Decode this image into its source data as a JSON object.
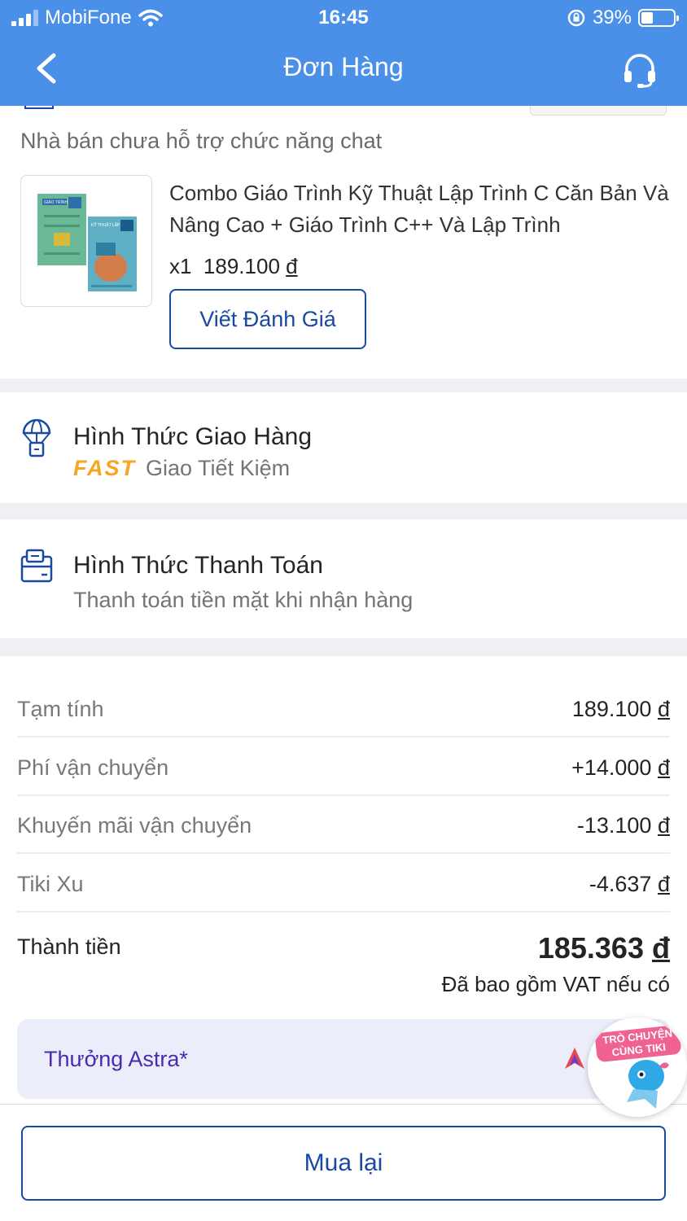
{
  "status_bar": {
    "carrier": "MobiFone",
    "time": "16:45",
    "battery": "39%"
  },
  "header": {
    "title": "Đơn Hàng"
  },
  "seller": {
    "chat_notice": "Nhà bán chưa hỗ trợ chức năng chat"
  },
  "product": {
    "name": "Combo Giáo Trình Kỹ Thuật Lập Trình C Căn Bản Và Nâng Cao + Giáo Trình C++ Và Lập Trình",
    "quantity": "x1",
    "price": "189.100",
    "currency": "đ",
    "review_button": "Viết Đánh Giá",
    "cover1_text": "GIÁO TRÌNH",
    "cover2_text": "KỸ THUẬT LẬP TRÌNH"
  },
  "shipping": {
    "title": "Hình Thức Giao Hàng",
    "badge": "FAST",
    "method": "Giao Tiết Kiệm"
  },
  "payment": {
    "title": "Hình Thức Thanh Toán",
    "method": "Thanh toán tiền mặt khi nhận hàng"
  },
  "summary": {
    "rows": [
      {
        "label": "Tạm tính",
        "value": "189.100"
      },
      {
        "label": "Phí vận chuyển",
        "value": "+14.000"
      },
      {
        "label": "Khuyến mãi vận chuyển",
        "value": "-13.100"
      },
      {
        "label": "Tiki Xu",
        "value": "-4.637"
      }
    ],
    "currency": "đ",
    "total_label": "Thành tiền",
    "total_value": "185.363",
    "vat_note": "Đã bao gồm VAT nếu có",
    "astra_label": "Thưởng Astra*"
  },
  "chat_widget": {
    "text": "TRÒ CHUYỆN CÙNG TIKI"
  },
  "bottom": {
    "rebuy_button": "Mua lại"
  },
  "colors": {
    "header_bg": "#4a90e8",
    "primary_blue": "#1a4aa0",
    "fast_orange": "#f6a623",
    "astra_purple": "#4a2bb0",
    "astra_bg": "#ecedfa"
  }
}
